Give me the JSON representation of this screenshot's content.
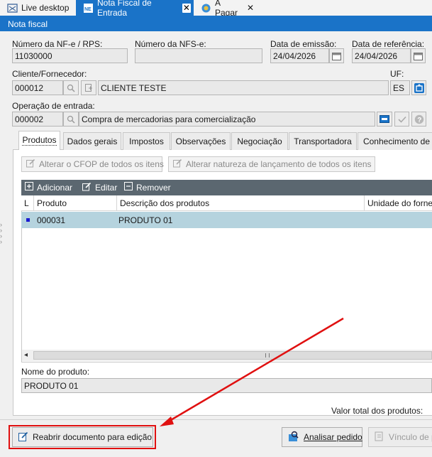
{
  "window_tabs": [
    {
      "label": "Live desktop",
      "icon": "live-desktop-icon",
      "active": false,
      "closable": false
    },
    {
      "label": "Nota Fiscal de Entrada",
      "icon": "nfe-icon",
      "active": true,
      "closable": true
    },
    {
      "label": "A Pagar",
      "icon": "a-pagar-icon",
      "active": false,
      "closable": true
    }
  ],
  "header": {
    "title": "Nota fiscal"
  },
  "fields": {
    "nfe_label": "Número da NF-e / RPS:",
    "nfe_value": "11030000",
    "nfse_label": "Número da NFS-e:",
    "nfse_value": "",
    "emissao_label": "Data de emissão:",
    "emissao_value": "24/04/2026",
    "referencia_label": "Data de referência:",
    "referencia_value": "24/04/2026",
    "cliente_label": "Cliente/Fornecedor:",
    "cliente_code": "000012",
    "cliente_name": "CLIENTE TESTE",
    "uf_label": "UF:",
    "uf_value": "ES",
    "operacao_label": "Operação de entrada:",
    "operacao_code": "000002",
    "operacao_desc": "Compra de mercadorias para comercialização"
  },
  "inner_tabs": [
    "Produtos",
    "Dados gerais",
    "Impostos",
    "Observações",
    "Negociação",
    "Transportadora",
    "Conhecimento de"
  ],
  "actions": {
    "alterar_cfop": "Alterar o CFOP de todos os itens",
    "alterar_natureza": "Alterar natureza de lançamento de todos os itens"
  },
  "grid_toolbar": {
    "add": "Adicionar",
    "edit": "Editar",
    "remove": "Remover"
  },
  "grid": {
    "columns": [
      "L",
      "Produto",
      "Descrição dos produtos",
      "Unidade do forne"
    ],
    "rows": [
      {
        "l": "",
        "produto": "000031",
        "descricao": "PRODUTO 01"
      }
    ]
  },
  "nome_produto": {
    "label": "Nome do produto:",
    "value": "PRODUTO 01"
  },
  "valor_total_label": "Valor total dos produtos:",
  "bottom_buttons": {
    "reabrir": "Reabrir documento para edição",
    "analisar": "Analisar pedido",
    "vinculo": "Vínculo de p"
  },
  "colors": {
    "accent": "#1a73c8",
    "highlight": "#e01010",
    "selected_row": "#b5d3de",
    "grid_toolbar": "#5b6770"
  }
}
